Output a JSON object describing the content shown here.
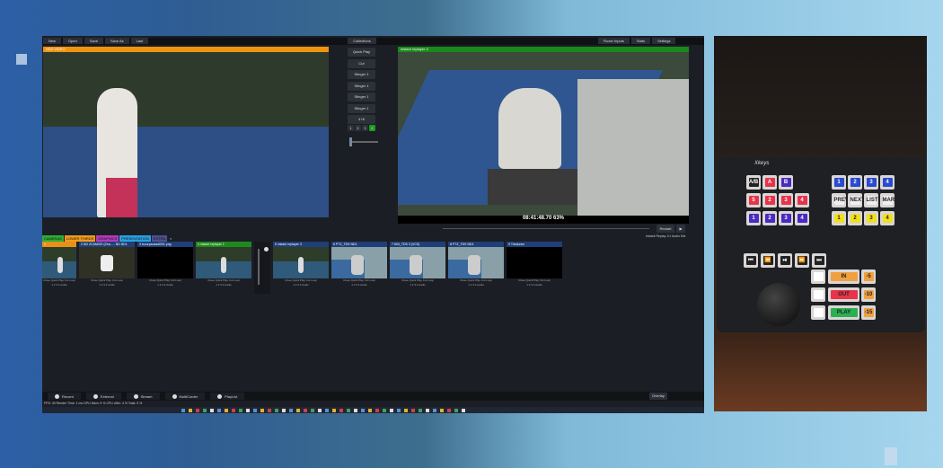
{
  "menu": [
    "New",
    "Open",
    "Save",
    "Save As",
    "Last"
  ],
  "menu_right": [
    "Fluxer Inputs",
    "Stats",
    "Settings"
  ],
  "collections": "Collections",
  "preview_title": "ND2 VIDEO",
  "program_title": "instant replayer  4",
  "transitions": [
    "Quick Play",
    "Cut",
    "Stinger 1",
    "Stinger 1",
    "Stinger 1",
    "Stinger 1",
    "4 Hi"
  ],
  "trans_numbers": [
    "1",
    "2",
    "3",
    "4"
  ],
  "timecode": "08:41:48.70  63%",
  "replay_button": "Restart",
  "replay_sub": "Instant Replay  1/1  Audio Mix",
  "tabs": [
    {
      "label": "CAMERAS",
      "color": "#2fae35"
    },
    {
      "label": "LOWER THIRDS",
      "color": "#f29a1b"
    },
    {
      "label": "GRAPHICS",
      "color": "#b03bbd"
    },
    {
      "label": "PRESENTATION",
      "color": "#2aa0e0"
    },
    {
      "label": "EXTRA",
      "color": "#4f4f8f"
    }
  ],
  "inputs": [
    {
      "title": "1",
      "color": "#e8901a",
      "kind": "tennis"
    },
    {
      "title": "2  ND ZCAM/ZD (Zha... - ND ND1",
      "color": "#1f3f78",
      "kind": "robot"
    },
    {
      "title": "3  tcourpanasdl001.png",
      "color": "#1f3f78",
      "kind": "black"
    },
    {
      "title": "4  instant replayer  1",
      "color": "#1e8a1e",
      "kind": "tennis"
    },
    {
      "title": "5  instant replayer  3",
      "color": "#1f3f78",
      "kind": "tennis"
    },
    {
      "title": "6  PTZ_TDS ND1",
      "color": "#1f3f78",
      "kind": "ptz"
    },
    {
      "title": "7  NDI_TDS 3 (VCS)",
      "color": "#1f3f78",
      "kind": "ptz"
    },
    {
      "title": "8  PTZ_TDS ND1",
      "color": "#1f3f78",
      "kind": "ptz"
    },
    {
      "title": "9  Tdsduran",
      "color": "#1f3f78",
      "kind": "black"
    }
  ],
  "input_controls": "Close  Quick Play  Cut  Loop",
  "input_numbers": "1 2 3 4  Audio",
  "bottom_buttons": [
    "Record",
    "External",
    "Stream",
    "MultiCorder",
    "PlayList"
  ],
  "overlay_label": "Overlay",
  "status_text": "FPS: 30  Render Time: 1 ms  GPU Mem: 5 %  CPU vMix: 4 %  Total: 5 %",
  "controller": {
    "brand": "Xkeys",
    "row1": [
      "A/B",
      "A",
      "B"
    ],
    "row2": [
      "5",
      "2",
      "3",
      "4"
    ],
    "row3": [
      "1",
      "2",
      "3",
      "4"
    ],
    "right_row1": [
      "1",
      "2",
      "3",
      "4"
    ],
    "right_row2": [
      "PREV",
      "NEXT",
      "LIST",
      "MARK"
    ],
    "right_row3": [
      "1",
      "2",
      "3",
      "4"
    ],
    "transport": [
      "⏮",
      "⏪",
      "⏯",
      "⏩",
      "⏭"
    ],
    "in": "IN",
    "out": "OUT",
    "play": "PLAY",
    "offsets": [
      "-5",
      "-10",
      "-15"
    ]
  }
}
